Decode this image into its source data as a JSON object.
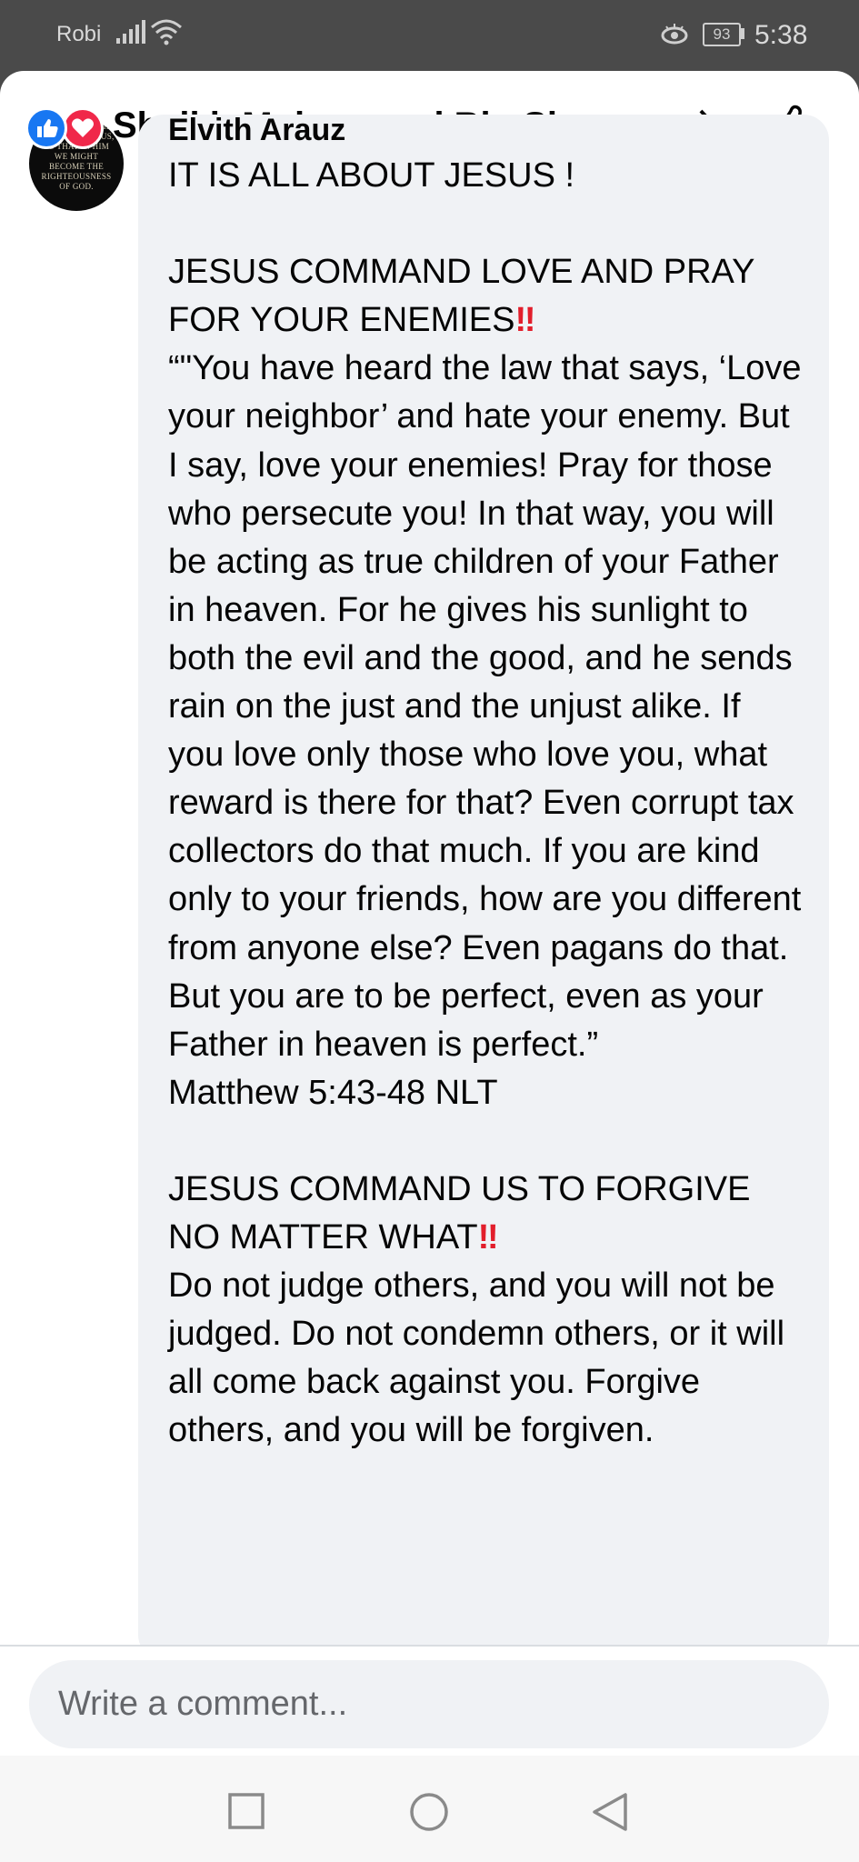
{
  "status_bar": {
    "carrier": "Robi",
    "battery": "93",
    "time": "5:38"
  },
  "header": {
    "title": "Sheikh Muhammad Bin Shams...",
    "icons": [
      "like-reaction-icon",
      "love-reaction-icon",
      "chevron-right-icon",
      "thumbs-up-icon"
    ]
  },
  "comment": {
    "author": "Elvith Arauz",
    "avatar_text": "WHO HAD NO SIN TO BE SIN FOR US, SO THAT IN HIM WE MIGHT BECOME THE RIGHTEOUSNESS OF GOD.",
    "line1": "IT IS ALL ABOUT JESUS !",
    "heading1": "JESUS COMMAND LOVE AND PRAY FOR YOUR ENEMIES",
    "heading1_mark": "‼",
    "quote": "“\"You have heard the law that says, ‘Love your neighbor’ and hate your enemy. But I say, love your enemies! Pray for those who persecute you! In that way, you will be acting as true children of your Father in heaven. For he gives his sunlight to both the evil and the good, and he sends rain on the just and the unjust alike. If you love only those who love you, what reward is there for that? Even corrupt tax collectors do that much. If you are kind only to your friends, how are you different from anyone else? Even pagans do that. But you are to be perfect, even as your Father in heaven is perfect.”",
    "reference": "Matthew 5:43-48 NLT",
    "heading2": "JESUS COMMAND US TO FORGIVE NO MATTER WHAT",
    "heading2_mark": "‼",
    "para2": "Do not judge others, and you will not be judged. Do not condemn others, or it will all come back against you. Forgive others, and you will be forgiven."
  },
  "composer": {
    "placeholder": "Write a comment..."
  },
  "nav": {
    "icons": [
      "recent-apps-icon",
      "home-icon",
      "back-icon"
    ]
  },
  "colors": {
    "facebook_blue": "#1877f2",
    "love_red": "#f0284a",
    "bubble_gray": "#f0f2f5",
    "exclamation_red": "#e21e2b"
  }
}
